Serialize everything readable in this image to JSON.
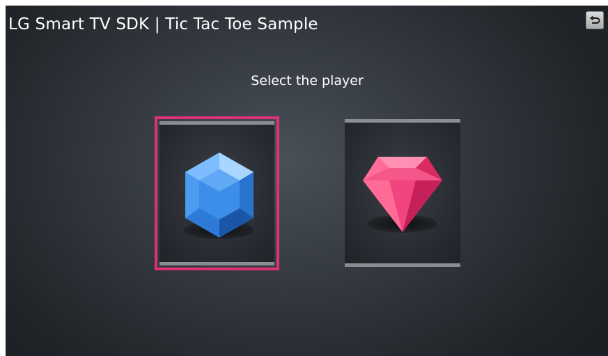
{
  "header": {
    "title": "LG Smart TV SDK | Tic Tac Toe Sample",
    "back_icon": "back-arrow-icon"
  },
  "main": {
    "prompt": "Select the player",
    "players": [
      {
        "icon": "blue-hexagon-gem-icon",
        "color": "#3f8ee6",
        "selected": true,
        "highlight_color": "#e0307a"
      },
      {
        "icon": "pink-diamond-gem-icon",
        "color": "#f0457e",
        "selected": false
      }
    ]
  }
}
